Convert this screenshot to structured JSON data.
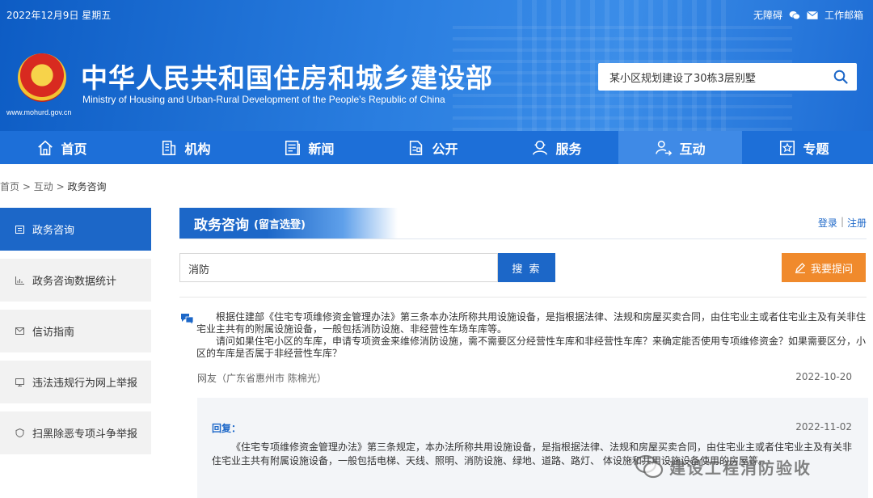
{
  "topbar": {
    "date": "2022年12月9日 星期五",
    "accessibility": "无障碍",
    "work_mail": "工作邮箱"
  },
  "site": {
    "url": "www.mohurd.gov.cn",
    "title": "中华人民共和国住房和城乡建设部",
    "subtitle": "Ministry of Housing and Urban-Rural Development of the People’s Republic of China"
  },
  "search": {
    "value": "某小区规划建设了30栋3层别墅"
  },
  "nav": [
    {
      "label": "首页",
      "icon": "home-icon"
    },
    {
      "label": "机构",
      "icon": "building-icon"
    },
    {
      "label": "新闻",
      "icon": "news-icon"
    },
    {
      "label": "公开",
      "icon": "document-icon"
    },
    {
      "label": "服务",
      "icon": "service-person-icon"
    },
    {
      "label": "互动",
      "icon": "interaction-icon",
      "active": true
    },
    {
      "label": "专题",
      "icon": "star-icon"
    }
  ],
  "breadcrumb": {
    "home": "首页",
    "sep": ">",
    "level2": "互动",
    "current": "政务咨询"
  },
  "sidebar": {
    "items": [
      {
        "label": "政务咨询",
        "icon": "list-icon",
        "active": true
      },
      {
        "label": "政务咨询数据统计",
        "icon": "chart-icon"
      },
      {
        "label": "信访指南",
        "icon": "mail-icon"
      },
      {
        "label": "违法违规行为网上举报",
        "icon": "monitor-icon"
      },
      {
        "label": "扫黑除恶专项斗争举报",
        "icon": "shield-icon"
      }
    ]
  },
  "main": {
    "section_title": "政务咨询",
    "section_sub": "(留言选登)",
    "login": "登录",
    "auth_sep": "|",
    "register": "注册",
    "query_value": "消防",
    "query_button": "搜 索",
    "ask_button": "我要提问"
  },
  "question": {
    "para1": "根据住建部《住宅专项维修资金管理办法》第三条本办法所称共用设施设备，是指根据法律、法规和房屋买卖合同，由住宅业主或者住宅业主及有关非住宅业主共有的附属设施设备，一般包括消防设施、非经营性车场车库等。",
    "para2": "请问如果住宅小区的车库，申请专项资金来维修消防设施，需不需要区分经营性车库和非经营性车库？来确定能否使用专项维修资金？如果需要区分，小区的车库是否属于非经营性车库？",
    "asker": "网友（广东省惠州市 陈棉光）",
    "date": "2022-10-20"
  },
  "reply": {
    "label": "回复：",
    "date": "2022-11-02",
    "text": "《住宅专项维修资金管理办法》第三条规定，本办法所称共用设施设备，是指根据法律、法规和房屋买卖合同，由住宅业主或者住宅业主及有关非住宅业主共有附属设施设备，一般包括电梯、天线、照明、消防设施、绿地、道路、路灯、 体设施和共用设施设备使用的房屋等。"
  },
  "watermark": {
    "text": "建设工程消防验收"
  },
  "colors": {
    "primary": "#1c67c8",
    "nav": "#1d6fd8",
    "orange": "#f08a2c"
  }
}
